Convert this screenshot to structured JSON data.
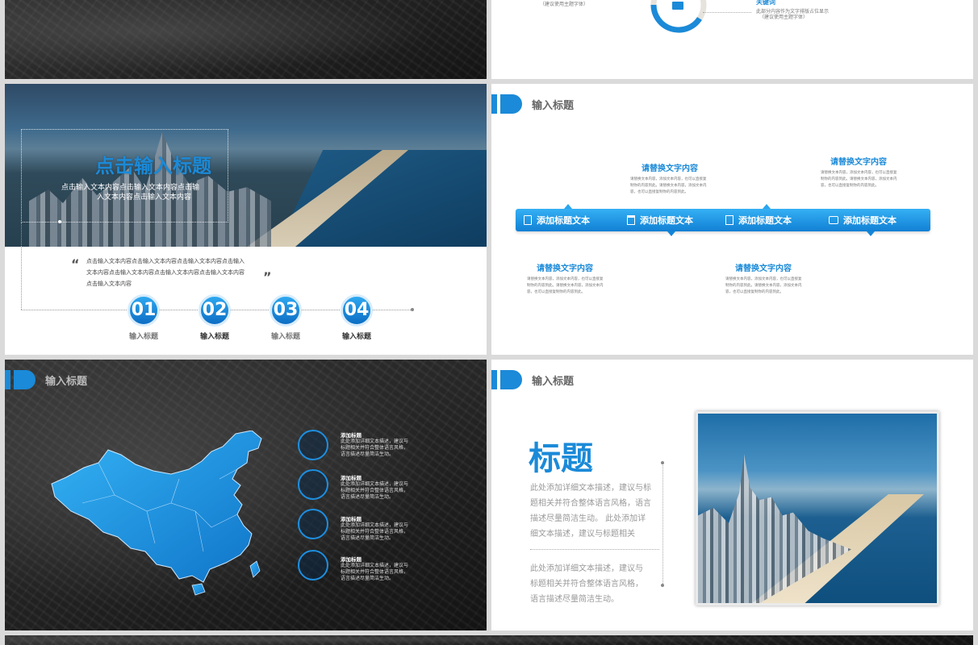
{
  "colors": {
    "accent": "#1b8ad8",
    "accent_dark": "#0d6ec4",
    "dark_bg": "#222222"
  },
  "slide2": {
    "keyword_label": "关键词",
    "desc_line1": "此部分内容作为文字排版占位显示",
    "desc_line2": "（建议使用主题字体）",
    "left_note": "（建议使用主题字体）"
  },
  "slide3": {
    "title": "点击输入标题",
    "subtitle_line1": "点击输入文本内容点击输入文本内容点击输",
    "subtitle_line2": "入文本内容点击输入文本内容",
    "quote_open": "“",
    "quote_close": "”",
    "quote_line1": "点击输入文本内容点击输入文本内容点击输入文本内容点击输入",
    "quote_line2": "文本内容点击输入文本内容点击输入文本内容点击输入文本内容",
    "quote_line3": "点击输入文本内容",
    "steps": [
      {
        "num": "01",
        "label": "输入标题"
      },
      {
        "num": "02",
        "label": "输入标题"
      },
      {
        "num": "03",
        "label": "输入标题"
      },
      {
        "num": "04",
        "label": "输入标题"
      }
    ]
  },
  "slide4": {
    "header": "输入标题",
    "bar_items": [
      "添加标题文本",
      "添加标题文本",
      "添加标题文本",
      "添加标题文本"
    ],
    "bar_icons": [
      "clipboard-icon",
      "trash-icon",
      "document-icon",
      "chat-icon"
    ],
    "callouts": [
      {
        "title": "请替换文字内容",
        "l1": "请替换文本内容，添加文本内容，也可以直接复",
        "l2": "制你的内容到此。请替换文本内容，添加文本内",
        "l3": "容，也可以直接复制你的内容到此。"
      },
      {
        "title": "请替换文字内容",
        "l1": "请替换文本内容，添加文本内容，也可以直接复",
        "l2": "制你的内容到此。请替换文本内容，添加文本内",
        "l3": "容，也可以直接复制你的内容到此。"
      },
      {
        "title": "请替换文字内容",
        "l1": "请替换文本内容，添加文本内容，也可以直接复",
        "l2": "制你的内容到此。请替换文本内容，添加文本内",
        "l3": "容，也可以直接复制你的内容到此。"
      },
      {
        "title": "请替换文字内容",
        "l1": "请替换文本内容，添加文本内容，也可以直接复",
        "l2": "制你的内容到此。请替换文本内容，添加文本内",
        "l3": "容，也可以直接复制你的内容到此。"
      }
    ]
  },
  "slide5": {
    "header": "输入标题",
    "features": [
      {
        "icon": "compass-icon",
        "title": "添加标题",
        "l1": "此处添加详细文本描述，建议与",
        "l2": "标题相关并符合整体语言风格，",
        "l3": "语言描述尽量简洁生动。"
      },
      {
        "icon": "speaker-icon",
        "title": "添加标题",
        "l1": "此处添加详细文本描述，建议与",
        "l2": "标题相关并符合整体语言风格，",
        "l3": "语言描述尽量简洁生动。"
      },
      {
        "icon": "laptop-icon",
        "title": "添加标题",
        "l1": "此处添加详细文本描述，建议与",
        "l2": "标题相关并符合整体语言风格，",
        "l3": "语言描述尽量简洁生动。"
      },
      {
        "icon": "tools-icon",
        "title": "添加标题",
        "l1": "此处添加详细文本描述，建议与",
        "l2": "标题相关并符合整体语言风格，",
        "l3": "语言描述尽量简洁生动。"
      }
    ]
  },
  "slide6": {
    "header": "输入标题",
    "big_title": "标题",
    "p1_l1": "此处添加详细文本描述，建议与标",
    "p1_l2": "题相关并符合整体语言风格，语言",
    "p1_l3": "描述尽量简洁生动。 此处添加详",
    "p1_l4": "细文本描述，建议与标题相关",
    "p2_l1": "此处添加详细文本描述，建议与",
    "p2_l2": "标题相关并符合整体语言风格，",
    "p2_l3": "语言描述尽量简洁生动。"
  }
}
